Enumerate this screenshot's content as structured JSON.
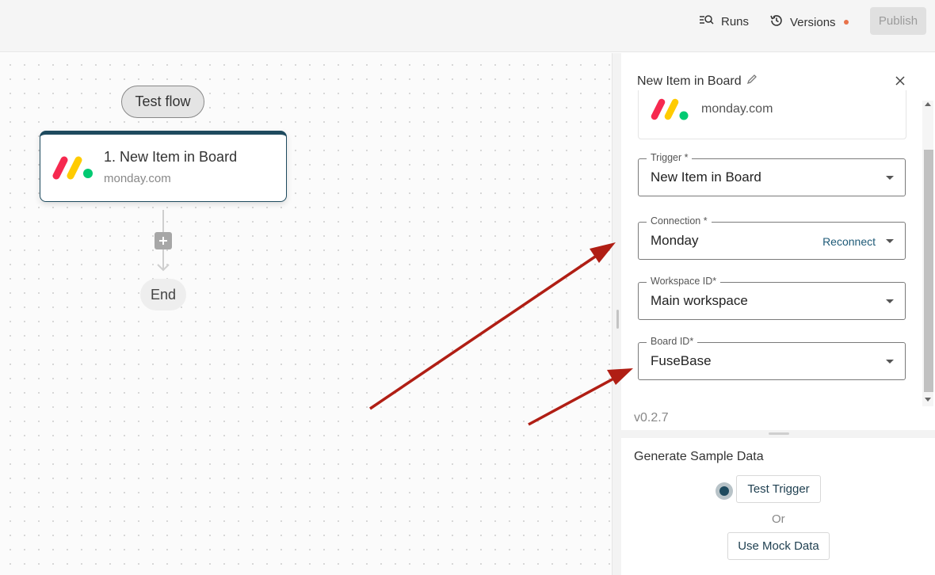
{
  "header": {
    "runs_label": "Runs",
    "versions_label": "Versions",
    "publish_label": "Publish",
    "versions_dot_color": "#e8724a"
  },
  "canvas": {
    "test_flow_label": "Test flow",
    "step": {
      "title": "1. New Item in Board",
      "subtitle": "monday.com",
      "icon": "monday-logo"
    },
    "add_icon": "plus-icon",
    "end_label": "End"
  },
  "panel": {
    "title": "New Item in Board",
    "piece_name": "monday.com",
    "trigger": {
      "label": "Trigger *",
      "value": "New Item in Board"
    },
    "connection": {
      "label": "Connection *",
      "value": "Monday",
      "action": "Reconnect"
    },
    "workspace": {
      "label": "Workspace ID*",
      "value": "Main workspace"
    },
    "board": {
      "label": "Board ID*",
      "value": "FuseBase"
    },
    "version": "v0.2.7"
  },
  "sample": {
    "title": "Generate Sample Data",
    "test_trigger_label": "Test Trigger",
    "or_label": "Or",
    "mock_label": "Use Mock Data"
  },
  "colors": {
    "accent": "#1e4a5e",
    "annotation_arrow": "#b01e14"
  }
}
